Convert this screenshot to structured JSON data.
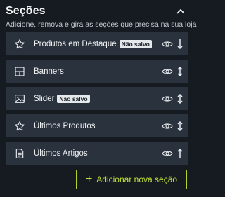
{
  "header": {
    "title": "Seções",
    "subtitle": "Adicione, remova e gira as seções que precisa na sua loja"
  },
  "sections": [
    {
      "label": "Produtos em Destaque",
      "badge": "Não salvo",
      "icon": "star-icon",
      "move": "arrow-down-icon"
    },
    {
      "label": "Banners",
      "badge": "",
      "icon": "grid-icon",
      "move": "arrow-up-down-icon"
    },
    {
      "label": "Slider",
      "badge": "Não salvo",
      "icon": "image-icon",
      "move": "arrow-up-down-icon"
    },
    {
      "label": "Últimos Produtos",
      "badge": "",
      "icon": "star-icon",
      "move": "arrow-up-down-icon"
    },
    {
      "label": "Últimos Artigos",
      "badge": "",
      "icon": "document-icon",
      "move": "arrow-up-icon"
    }
  ],
  "add_button": {
    "icon": "+",
    "label": "Adicionar nova seção"
  },
  "colors": {
    "background": "#161b21",
    "card": "#2a323d",
    "accent": "#b4d32e"
  }
}
